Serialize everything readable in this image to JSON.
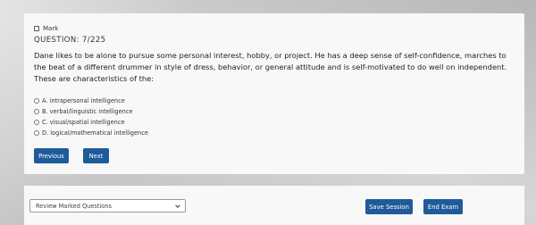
{
  "question": {
    "mark_label": "Mark",
    "title": "QUESTION: 7/225",
    "text": "Dane likes to be alone to pursue some personal interest, hobby, or project. He has a deep sense of self-confidence, marches to the beat of a different drummer in style of dress, behavior, or general attitude and is self-motivated to do well on independent. These are characteristics of the:",
    "options": [
      {
        "label": "A. intrapersonal intelligence"
      },
      {
        "label": "B. verbal/linguistic intelligence"
      },
      {
        "label": "C. visual/spatial intelligence"
      },
      {
        "label": "D. logical/mathematical intelligence"
      }
    ]
  },
  "nav": {
    "previous_label": "Previous",
    "next_label": "Next"
  },
  "footer": {
    "review_select_value": "Review Marked Questions",
    "save_label": "Save Session",
    "end_label": "End Exam"
  },
  "colors": {
    "button": "#1f5b9a",
    "card": "#f8f8f8"
  }
}
